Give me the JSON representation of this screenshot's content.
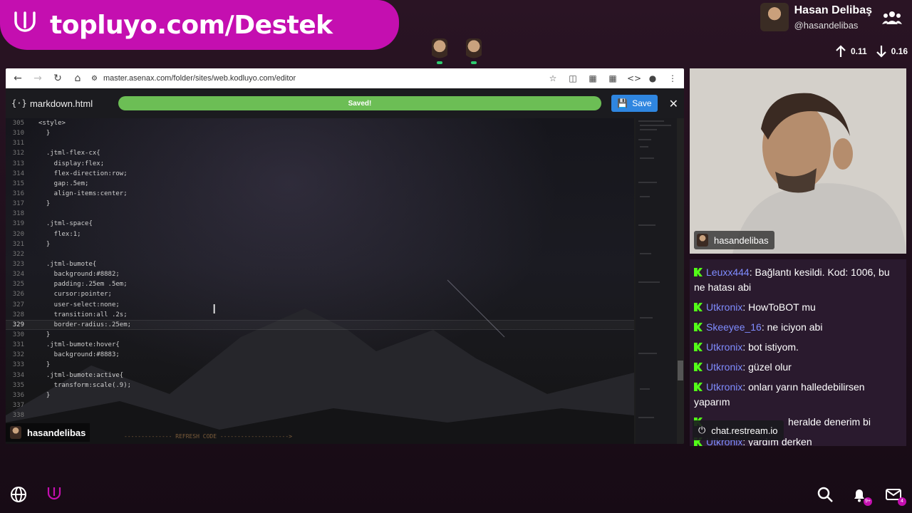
{
  "brand": {
    "text": "topluyo.com/Destek"
  },
  "profile": {
    "name": "Hasan Delibaş",
    "handle": "@hasandelibas",
    "up_value": "0.11",
    "down_value": "0.16"
  },
  "browser": {
    "url": "master.asenax.com/folder/sites/web.kodluyo.com/editor",
    "file_name": "markdown.html",
    "status": "Saved!",
    "save_label": "Save",
    "user_label": "hasandelibas",
    "footer_code": "-------------- REFRESH CODE -------------------->"
  },
  "code": [
    {
      "n": "305",
      "t": "<style>"
    },
    {
      "n": "310",
      "t": "  }"
    },
    {
      "n": "311",
      "t": ""
    },
    {
      "n": "312",
      "t": "  .jtml-flex-cx{"
    },
    {
      "n": "313",
      "t": "    display:flex;"
    },
    {
      "n": "314",
      "t": "    flex-direction:row;"
    },
    {
      "n": "315",
      "t": "    gap:.5em;"
    },
    {
      "n": "316",
      "t": "    align-items:center;"
    },
    {
      "n": "317",
      "t": "  }"
    },
    {
      "n": "318",
      "t": ""
    },
    {
      "n": "319",
      "t": "  .jtml-space{"
    },
    {
      "n": "320",
      "t": "    flex:1;"
    },
    {
      "n": "321",
      "t": "  }"
    },
    {
      "n": "322",
      "t": ""
    },
    {
      "n": "323",
      "t": "  .jtml-bumote{"
    },
    {
      "n": "324",
      "t": "    background:#8882;"
    },
    {
      "n": "325",
      "t": "    padding:.25em .5em;"
    },
    {
      "n": "326",
      "t": "    cursor:pointer;"
    },
    {
      "n": "327",
      "t": "    user-select:none;"
    },
    {
      "n": "328",
      "t": "    transition:all .2s;"
    },
    {
      "n": "329",
      "t": "    border-radius:.25em;"
    },
    {
      "n": "330",
      "t": "  }"
    },
    {
      "n": "331",
      "t": "  .jtml-bumote:hover{"
    },
    {
      "n": "332",
      "t": "    background:#8883;"
    },
    {
      "n": "333",
      "t": "  }"
    },
    {
      "n": "334",
      "t": "  .jtml-bumote:active{"
    },
    {
      "n": "335",
      "t": "    transform:scale(.9);"
    },
    {
      "n": "336",
      "t": "  }"
    },
    {
      "n": "337",
      "t": ""
    },
    {
      "n": "338",
      "t": ""
    }
  ],
  "active_line": "329",
  "webcam": {
    "label": "hasandelibas"
  },
  "chat": {
    "messages": [
      {
        "user": "Leuxx444",
        "text": "Bağlantı kesildi. Kod: 1006, bu ne hatası abi"
      },
      {
        "user": "Utkronix",
        "text": "HowToBOT mu"
      },
      {
        "user": "Skeeyee_16",
        "text": "ne iciyon abi"
      },
      {
        "user": "Utkronix",
        "text": "bot istiyom."
      },
      {
        "user": "Utkronix",
        "text": "güzel olur"
      },
      {
        "user": "Utkronix",
        "text": "onları yarın halledebilirsen yaparım"
      },
      {
        "user": "",
        "text": "heralde denerim bi"
      },
      {
        "user": "Utkronix",
        "text": "yardım derken"
      }
    ],
    "overlay_label": "chat.restream.io"
  },
  "bottom": {
    "mail_badge": "4",
    "bell_badge": "9+"
  },
  "colors": {
    "brand": "#c40fb0",
    "saved": "#6cbe55",
    "save_button": "#2f86e0",
    "chat_user": "#7f8cff",
    "kick_green": "#53fc18"
  }
}
